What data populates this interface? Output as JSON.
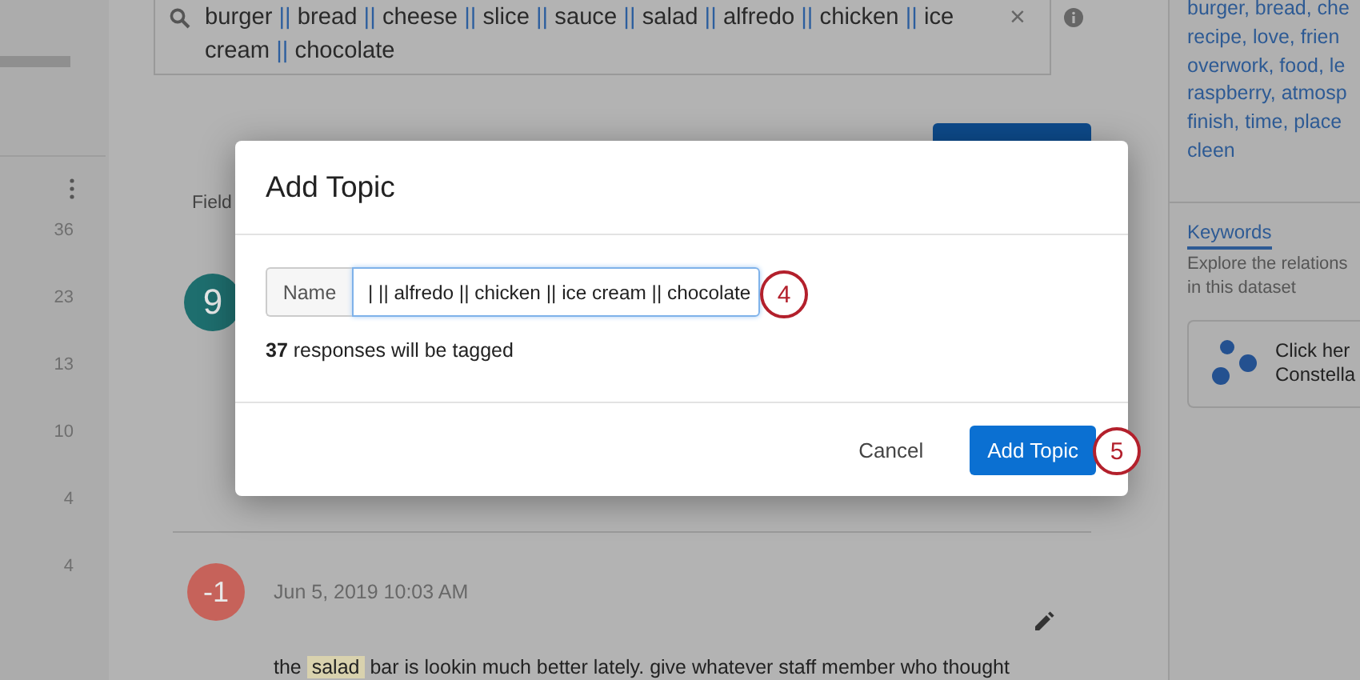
{
  "left_rail": {
    "row_counts": [
      "36",
      "23",
      "13",
      "10",
      "4",
      "4"
    ]
  },
  "search": {
    "tokens": [
      {
        "kind": "term",
        "text": "burger"
      },
      {
        "kind": "operator",
        "text": "||"
      },
      {
        "kind": "term",
        "text": "bread"
      },
      {
        "kind": "operator",
        "text": "||"
      },
      {
        "kind": "term",
        "text": "cheese"
      },
      {
        "kind": "operator",
        "text": "||"
      },
      {
        "kind": "term",
        "text": "slice"
      },
      {
        "kind": "operator",
        "text": "||"
      },
      {
        "kind": "term",
        "text": "sauce"
      },
      {
        "kind": "operator",
        "text": "||"
      },
      {
        "kind": "term",
        "text": "salad"
      },
      {
        "kind": "operator",
        "text": "||"
      },
      {
        "kind": "term",
        "text": "alfredo"
      },
      {
        "kind": "operator",
        "text": "||"
      },
      {
        "kind": "term",
        "text": "chicken"
      },
      {
        "kind": "operator",
        "text": "||"
      },
      {
        "kind": "term",
        "text": "ice cream"
      },
      {
        "kind": "operator",
        "text": "||"
      },
      {
        "kind": "term",
        "text": "chocolate"
      }
    ],
    "clear_icon": "×"
  },
  "field_label": "Field",
  "responses": [
    {
      "score": "9",
      "color": "#1e6e6e"
    },
    {
      "score": "-1",
      "color": "#c6625a",
      "date": "Jun 5, 2019 10:03 AM",
      "text_parts": [
        {
          "text": "the ",
          "highlight": false
        },
        {
          "text": "salad",
          "highlight": true
        },
        {
          "text": " bar is lookin much better lately. give whatever staff member who thought",
          "highlight": false
        }
      ]
    }
  ],
  "right_panel": {
    "topic_keywords": [
      "burger, bread, che",
      "recipe, love, frien",
      "overwork, food, le",
      "raspberry, atmosp",
      "finish, time, place",
      "cleen"
    ],
    "tab": {
      "label": "Keywords",
      "selected": true
    },
    "description": [
      "Explore the relations",
      "in this dataset"
    ],
    "card_lines": [
      "Click her",
      "Constella"
    ]
  },
  "modal": {
    "title": "Add Topic",
    "name_label": "Name",
    "name_value": "| || alfredo || chicken || ice cream || chocolate",
    "count_text": "**37** responses will be tagged",
    "buttons": [
      {
        "label": "Cancel",
        "kind": "secondary"
      },
      {
        "label": "Add Topic",
        "kind": "primary"
      }
    ]
  },
  "annotations": [
    {
      "label": "4"
    },
    {
      "label": "5"
    }
  ]
}
